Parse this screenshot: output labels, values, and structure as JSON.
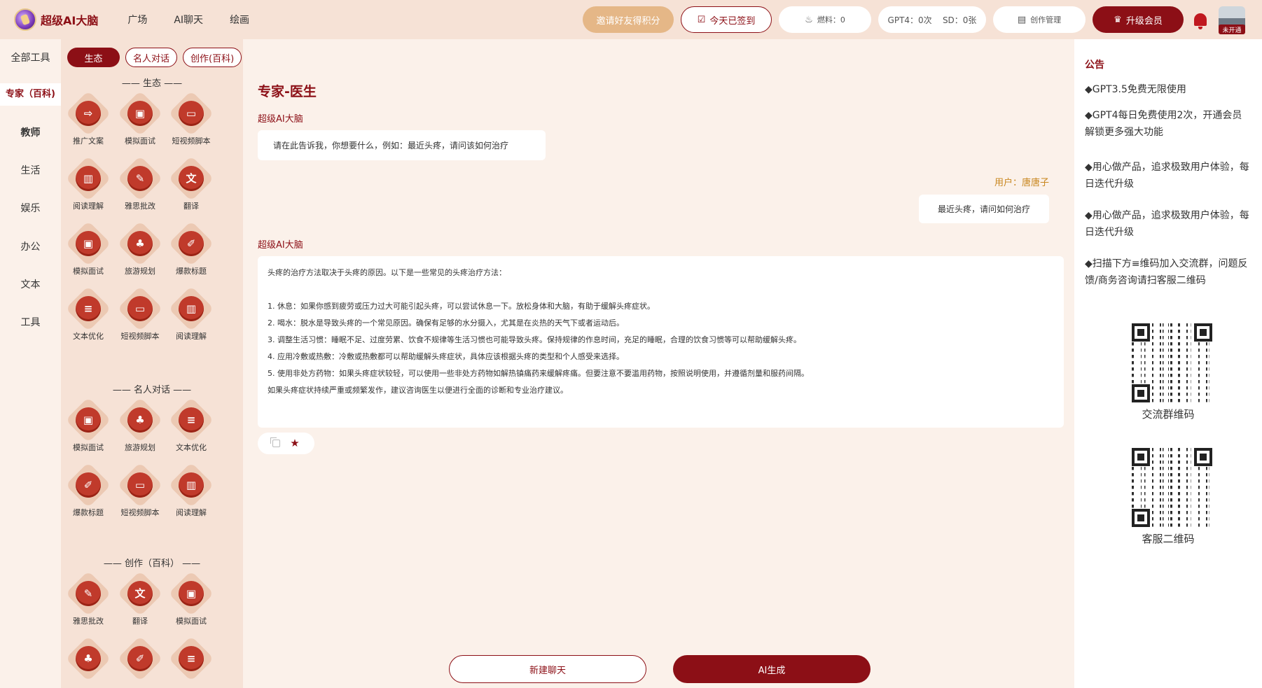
{
  "header": {
    "logo_text": "超级AI大脑",
    "nav": [
      "广场",
      "AI聊天",
      "绘画"
    ],
    "invite_label": "邀请好友得积分",
    "signin_label": "今天已签到",
    "fuel_label": "燃料：0",
    "quota_label": "GPT4：0次    SD：0张",
    "manage_label": "创作管理",
    "upgrade_label": "升级会员",
    "avatar_badge": "未开通"
  },
  "categories": [
    {
      "label": "全部工具"
    },
    {
      "label": "专家（百科)"
    },
    {
      "label": "教师"
    },
    {
      "label": "生活"
    },
    {
      "label": "娱乐"
    },
    {
      "label": "办公"
    },
    {
      "label": "文本"
    },
    {
      "label": "工具"
    }
  ],
  "tabs": [
    "生态",
    "名人对话",
    "创作(百科)"
  ],
  "sections": [
    {
      "title": "—— 生态 ——",
      "tools": [
        {
          "label": "推广文案",
          "icon": "share-icon"
        },
        {
          "label": "模拟面试",
          "icon": "briefcase-icon"
        },
        {
          "label": "短视频脚本",
          "icon": "monitor-icon"
        },
        {
          "label": "阅读理解",
          "icon": "book-icon"
        },
        {
          "label": "雅思批改",
          "icon": "edit-doc-icon"
        },
        {
          "label": "翻译",
          "icon": "translate-icon"
        },
        {
          "label": "模拟面试",
          "icon": "briefcase-icon"
        },
        {
          "label": "旅游规划",
          "icon": "palm-tree-icon"
        },
        {
          "label": "爆款标题",
          "icon": "notebook-icon"
        },
        {
          "label": "文本优化",
          "icon": "document-icon"
        },
        {
          "label": "短视频脚本",
          "icon": "monitor-icon"
        },
        {
          "label": "阅读理解",
          "icon": "book-icon"
        }
      ]
    },
    {
      "title": "—— 名人对话 ——",
      "tools": [
        {
          "label": "模拟面试",
          "icon": "briefcase-icon"
        },
        {
          "label": "旅游规划",
          "icon": "palm-tree-icon"
        },
        {
          "label": "文本优化",
          "icon": "document-icon"
        },
        {
          "label": "爆款标题",
          "icon": "notebook-icon"
        },
        {
          "label": "短视频脚本",
          "icon": "monitor-icon"
        },
        {
          "label": "阅读理解",
          "icon": "book-icon"
        }
      ]
    },
    {
      "title": "—— 创作（百科） ——",
      "tools": [
        {
          "label": "雅思批改",
          "icon": "edit-doc-icon"
        },
        {
          "label": "翻译",
          "icon": "translate-icon"
        },
        {
          "label": "模拟面试",
          "icon": "briefcase-icon"
        },
        {
          "label": "",
          "icon": "palm-tree-icon"
        },
        {
          "label": "",
          "icon": "notebook-icon"
        },
        {
          "label": "",
          "icon": "document-icon"
        }
      ]
    }
  ],
  "main": {
    "title": "专家-医生",
    "ai_name": "超级AI大脑",
    "hint": "请在此告诉我，你想要什么，例如：最近头疼，请问该如何治疗",
    "user_label": "用户：唐唐子",
    "user_message": "最近头疼，请问如何治疗",
    "answer_lines": [
      "头疼的治疗方法取决于头疼的原因。以下是一些常见的头疼治疗方法：",
      "1. 休息：如果你感到疲劳或压力过大可能引起头疼，可以尝试休息一下。放松身体和大脑，有助于缓解头疼症状。",
      "2. 喝水：脱水是导致头疼的一个常见原因。确保有足够的水分摄入，尤其是在炎热的天气下或者运动后。",
      "3. 调整生活习惯：睡眠不足、过度劳累、饮食不规律等生活习惯也可能导致头疼。保持规律的作息时间，充足的睡眠，合理的饮食习惯等可以帮助缓解头疼。",
      "4. 应用冷敷或热敷：冷敷或热敷都可以帮助缓解头疼症状，具体应该根据头疼的类型和个人感受来选择。",
      "5. 使用非处方药物：如果头疼症状较轻，可以使用一些非处方药物如解热镇痛药来缓解疼痛。但要注意不要滥用药物，按照说明使用，并遵循剂量和服药间隔。",
      "如果头疼症状持续严重或频繁发作，建议咨询医生以便进行全面的诊断和专业治疗建议。"
    ],
    "new_chat_label": "新建聊天",
    "generate_label": "AI生成"
  },
  "notice": {
    "title": "公告",
    "items": [
      "◆GPT3.5免费无限使用",
      "◆GPT4每日免费使用2次，开通会员解锁更多强大功能",
      "◆用心做产品，追求极致用户体验，每日迭代升级",
      "◆用心做产品，追求极致用户体验，每日迭代升级",
      "◆扫描下方≡维码加入交流群，问题反馈/商务咨询请扫客服二维码"
    ],
    "qr_group_label": "交流群维码",
    "qr_service_label": "客服二维码"
  },
  "colors": {
    "accent": "#8c0f16",
    "header_bg": "#f6e2d6",
    "invite_bg": "#e5b787"
  }
}
